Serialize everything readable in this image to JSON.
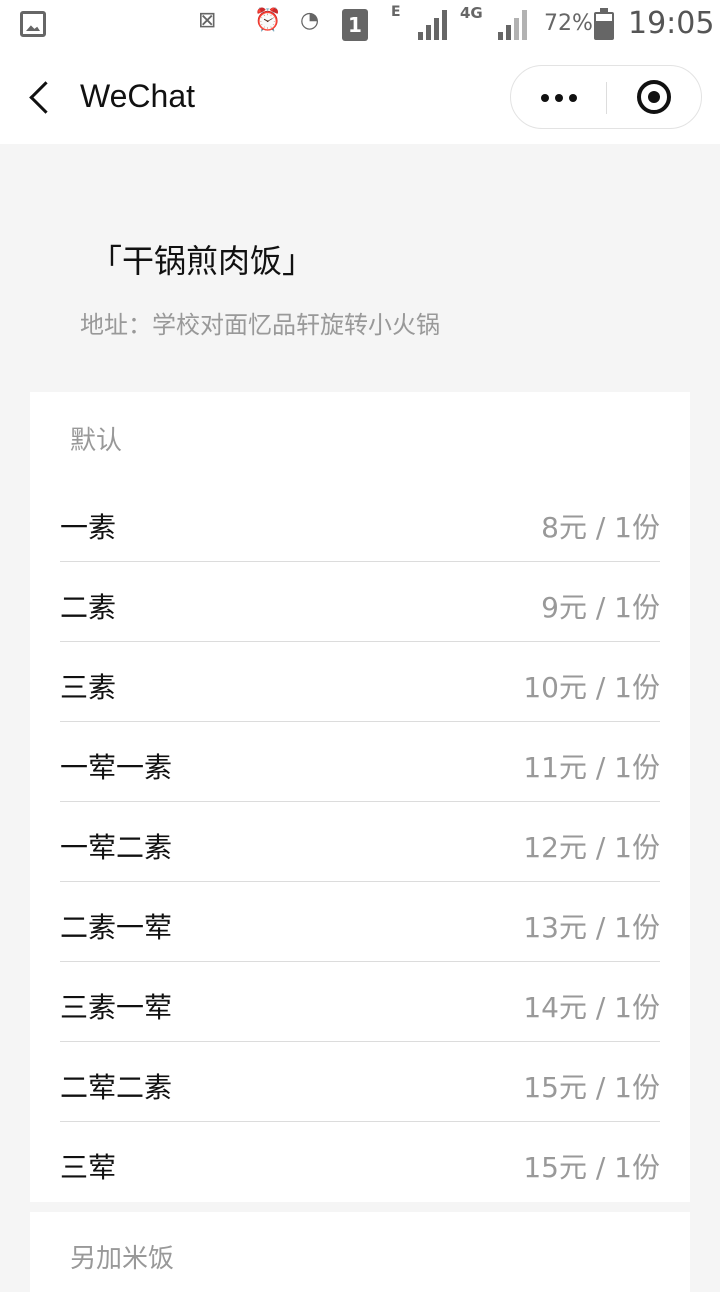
{
  "status_bar": {
    "battery": "72%",
    "time": "19:05",
    "network_e": "E",
    "network_4g": "4G",
    "sim": "1"
  },
  "nav": {
    "title": "WeChat"
  },
  "shop": {
    "title": "「干锅煎肉饭」",
    "address": "地址：学校对面忆品轩旋转小火锅"
  },
  "sections": [
    {
      "header": "默认",
      "items": [
        {
          "name": "一素",
          "price": "8元 / 1份"
        },
        {
          "name": "二素",
          "price": "9元 / 1份"
        },
        {
          "name": "三素",
          "price": "10元 / 1份"
        },
        {
          "name": "一荤一素",
          "price": "11元 / 1份"
        },
        {
          "name": "一荤二素",
          "price": "12元 / 1份"
        },
        {
          "name": "二素一荤",
          "price": "13元 / 1份"
        },
        {
          "name": "三素一荤",
          "price": "14元 / 1份"
        },
        {
          "name": "二荤二素",
          "price": "15元 / 1份"
        },
        {
          "name": "三荤",
          "price": "15元 / 1份"
        }
      ]
    },
    {
      "header": "另加米饭",
      "items": []
    }
  ]
}
